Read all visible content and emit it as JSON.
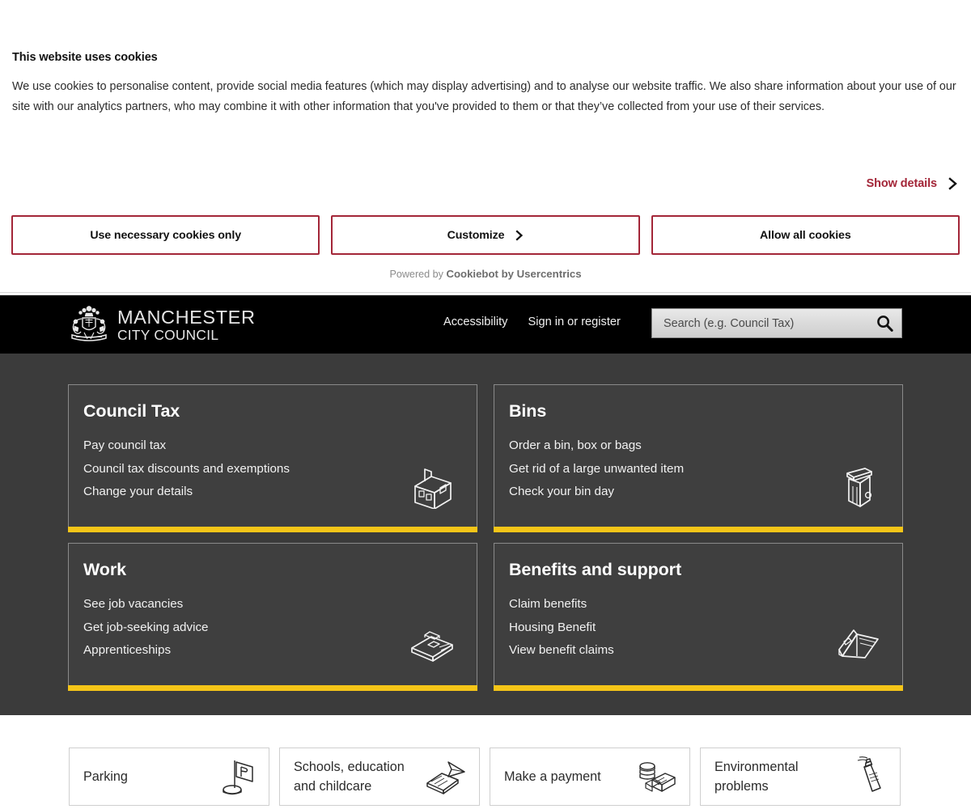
{
  "cookie_banner": {
    "title": "This website uses cookies",
    "body": "We use cookies to personalise content, provide social media features (which may display advertising) and to analyse our website traffic. We also share information about your use of our site with our analytics partners, who may combine it with other information that you've provided to them or that they’ve collected from your use of their services.",
    "show_details_label": "Show details",
    "buttons": [
      {
        "label": "Use necessary cookies only",
        "has_chevron": false
      },
      {
        "label": "Customize",
        "has_chevron": true
      },
      {
        "label": "Allow all cookies",
        "has_chevron": false
      }
    ],
    "powered_prefix": "Powered by ",
    "powered_brand": "Cookiebot by Usercentrics",
    "accent_color": "#a32638"
  },
  "header": {
    "logo_line1": "MANCHESTER",
    "logo_line2": "CITY COUNCIL",
    "logo_icon": "coat-of-arms-crest-icon",
    "links": [
      {
        "label": "Accessibility"
      },
      {
        "label": "Sign in or register"
      }
    ],
    "search": {
      "placeholder": "Search (e.g. Council Tax)",
      "value": "",
      "icon": "search-icon"
    },
    "background_color": "#000000"
  },
  "main": {
    "background_color": "#3b3b3b",
    "accent_bar_color": "#f5c518",
    "cards": [
      {
        "title": "Council Tax",
        "icon": "house-icon",
        "links": [
          "Pay council tax",
          "Council tax discounts and exemptions",
          "Change your details"
        ]
      },
      {
        "title": "Bins",
        "icon": "wheelie-bin-icon",
        "links": [
          "Order a bin, box or bags",
          "Get rid of a large unwanted item",
          "Check your bin day"
        ]
      },
      {
        "title": "Work",
        "icon": "briefcase-icon",
        "links": [
          "See job vacancies",
          "Get job-seeking advice",
          "Apprenticeships"
        ]
      },
      {
        "title": "Benefits and support",
        "icon": "open-folder-icon",
        "links": [
          "Claim benefits",
          "Housing Benefit",
          "View benefit claims"
        ]
      }
    ]
  },
  "tiles": [
    {
      "label": "Parking",
      "icon": "parking-sign-icon"
    },
    {
      "label": "Schools, education and childcare",
      "icon": "book-pencil-icon"
    },
    {
      "label": "Make a payment",
      "icon": "money-cash-icon"
    },
    {
      "label": "Environmental problems",
      "icon": "spray-can-icon"
    }
  ]
}
